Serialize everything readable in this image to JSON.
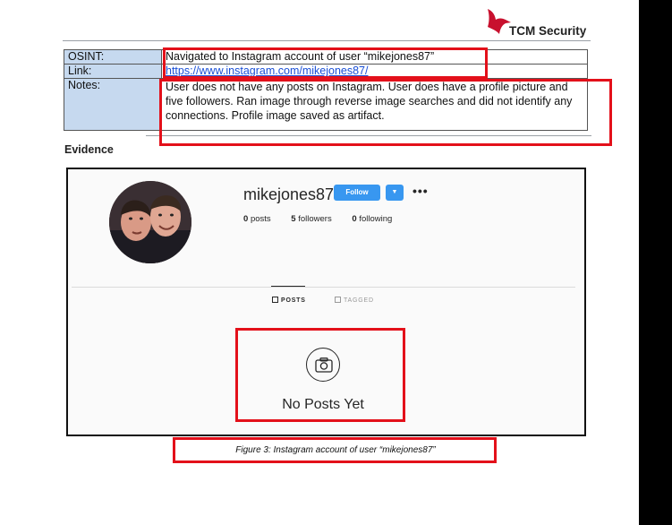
{
  "logo": {
    "text": "TCM Security",
    "brand_color": "#c8102e"
  },
  "table": {
    "rows": [
      {
        "key": "OSINT:",
        "value": "Navigated to Instagram account of user “mikejones87”"
      },
      {
        "key": "Link:",
        "value": "https://www.instagram.com/mikejones87/"
      },
      {
        "key": "Notes:",
        "value": "User does not have any posts on Instagram.  User does have a profile picture and five followers.  Ran image through reverse image searches and did not identify any connections.  Profile image saved as artifact."
      }
    ],
    "key_bg_color": "#c6d9ef",
    "link_color": "#1a4fd6"
  },
  "evidence_heading": "Evidence",
  "instagram": {
    "username": "mikejones87",
    "follow_label": "Follow",
    "dropdown_icon": "caret-down-icon",
    "more_icon": "more-dots-icon",
    "more_label": "•••",
    "stats": {
      "posts_count": "0",
      "posts_label": "posts",
      "followers_count": "5",
      "followers_label": "followers",
      "following_count": "0",
      "following_label": "following"
    },
    "tabs": [
      {
        "label": "POSTS",
        "active": true
      },
      {
        "label": "TAGGED",
        "active": false
      }
    ],
    "empty_icon": "camera-icon",
    "empty_text": "No Posts Yet",
    "accent_color": "#3897f0"
  },
  "caption": "Figure 3: Instagram account of user “mikejones87”",
  "annotation_color": "#e3101a"
}
